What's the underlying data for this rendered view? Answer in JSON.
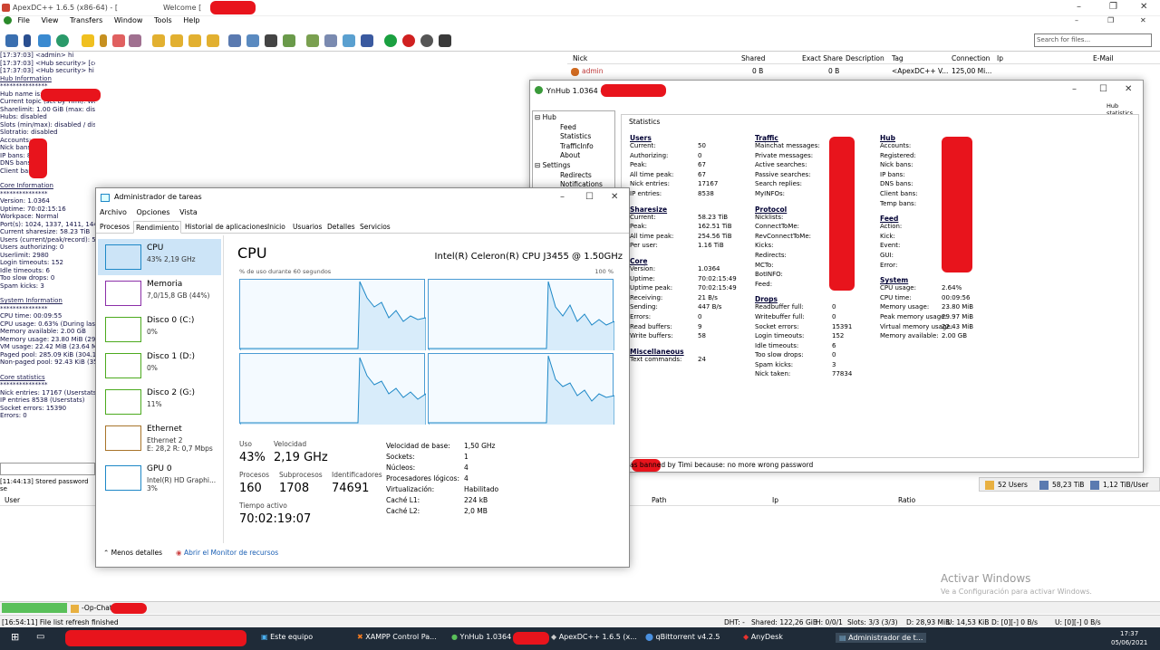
{
  "apex": {
    "title": "ApexDC++ 1.6.5 (x86-64) - [",
    "title_welcome": "Welcome [",
    "menu": [
      "File",
      "View",
      "Transfers",
      "Window",
      "Tools",
      "Help"
    ],
    "search_placeholder": "Search for files...",
    "chat": [
      {
        "ts": "[17:37:03]",
        "text": " <admin> hi"
      },
      {
        "ts": "[17:37:03]",
        "text": " <Hub security> [command] hi"
      },
      {
        "ts": "[17:37:03]",
        "text": " <Hub security> hi"
      }
    ],
    "hub_info_title": "Hub Information",
    "stars": "***************",
    "hub_info": [
      "Hub name is:",
      "Current topic (set by Timi): Welcome",
      "Sharelimit: 1.00 GiB (max: disabled)",
      "Hubs: disabled",
      "Slots (min/max): disabled / disabled",
      "Slotratio: disabled",
      "Accounts:",
      "Nick bans:",
      "IP bans: 8",
      "DNS bans:",
      "Client bans:"
    ],
    "core_info_title": "Core Information",
    "core_info": [
      "Version: 1.0364",
      "Uptime: 70:02:15:16",
      "Workpace: Normal",
      "Port(s): 1024, 1337, 1411, 1441,",
      "Current sharesize: 58.23 TiB",
      "Users (current/peak/record): 50",
      "Users authorizing: 0",
      "Userlimit: 2980",
      "Login timeouts: 152",
      "Idle timeouts: 6",
      "Too slow drops: 0",
      "Spam kicks: 3"
    ],
    "sys_info_title": "System Information",
    "sys_info": [
      "CPU time: 00:09:55",
      "CPU usage: 0.63% (During last 3",
      "Memory available: 2.00 GB",
      "Memory usage: 23.80 MiB (29.97",
      "VM usage: 22.42 MiB (23.64 Mi",
      "Paged pool: 285.09 KiB (304.10",
      "Non-paged pool: 92.43 KiB (359"
    ],
    "core_stats_title": "Core statistics",
    "core_stats": [
      "Nick entries: 17167 (Userstats)",
      "IP entries 8538 (Userstats)",
      "Socket errors: 15390",
      "Errors: 0"
    ],
    "userlist_cols": [
      "Nick",
      "Shared",
      "Exact Share",
      "Description",
      "Tag",
      "Connection",
      "Ip",
      "E-Mail"
    ],
    "user_row": {
      "nick": "admin",
      "shared": "0 B",
      "exact": "0 B",
      "tag": "<ApexDC++ V...",
      "conn": "125,00 Mi..."
    },
    "pwd_line": "[11:44:13] Stored password se",
    "right_status": {
      "users": "52 Users",
      "share": "58,23 TiB",
      "rate": "1,12 TiB/User"
    },
    "queue_cols": [
      "User",
      "Path",
      "Ip",
      "Ratio"
    ],
    "activate": "Activar Windows",
    "activate_sub": "Ve a Configuración para activar Windows.",
    "op_chat": "-Op-Chat-",
    "bottom_msg": "[16:54:11] File list refresh finished",
    "bottom_status": [
      "DHT: -",
      "Shared: 122,26 GiB",
      "H: 0/0/1",
      "Slots: 3/3 (3/3)",
      "D: 28,93 MiB",
      "U: 14,53 KiB",
      "D: [0][-] 0 B/s",
      "U: [0][-] 0 B/s"
    ]
  },
  "ynhub": {
    "title": "YnHub 1.0364 -",
    "subtitle": "Hub statistics",
    "tree": [
      "Hub",
      "Feed",
      "Statistics",
      "TrafficInfo",
      "About",
      "Settings",
      "Redirects",
      "Notifications"
    ],
    "panel_head": "Statistics",
    "banned": "as banned by Timi because: no more wrong password",
    "cols": [
      {
        "sections": [
          {
            "h": "Users",
            "rows": [
              [
                "Current:",
                "50"
              ],
              [
                "Authorizing:",
                "0"
              ],
              [
                "Peak:",
                "67"
              ],
              [
                "All time peak:",
                "67"
              ],
              [
                "Nick entries:",
                "17167"
              ],
              [
                "IP entries:",
                "8538"
              ]
            ]
          },
          {
            "h": "Sharesize",
            "rows": [
              [
                "Current:",
                "58.23 TiB"
              ],
              [
                "Peak:",
                "162.51 TiB"
              ],
              [
                "All time peak:",
                "254.56 TiB"
              ],
              [
                "Per user:",
                "1.16 TiB"
              ]
            ]
          },
          {
            "h": "Core",
            "rows": [
              [
                "Version:",
                "1.0364"
              ],
              [
                "Uptime:",
                "70:02:15:49"
              ],
              [
                "Uptime peak:",
                "70:02:15:49"
              ],
              [
                "Receiving:",
                "21 B/s"
              ],
              [
                "Sending:",
                "447 B/s"
              ],
              [
                "Errors:",
                "0"
              ],
              [
                "Read buffers:",
                "9"
              ],
              [
                "Write buffers:",
                "58"
              ]
            ]
          },
          {
            "h": "Miscellaneous",
            "rows": [
              [
                "Text commands:",
                "24"
              ]
            ]
          }
        ]
      },
      {
        "sections": [
          {
            "h": "Traffic",
            "rows": [
              [
                "Mainchat messages:",
                ""
              ],
              [
                "Private messages:",
                ""
              ],
              [
                "Active searches:",
                "77"
              ],
              [
                "Passive searches:",
                "67"
              ],
              [
                "Search replies:",
                "9"
              ],
              [
                "MyINFOs:",
                "55"
              ]
            ]
          },
          {
            "h": "Protocol",
            "rows": [
              [
                "Nicklists:",
                ""
              ],
              [
                "ConnectToMe:",
                "30"
              ],
              [
                "RevConnectToMe:",
                "36"
              ],
              [
                "Kicks:",
                ""
              ],
              [
                "Redirects:",
                ""
              ],
              [
                "MCTo:",
                ""
              ],
              [
                "BotINFO:",
                ""
              ],
              [
                "Feed:",
                ""
              ]
            ]
          },
          {
            "h": "Drops",
            "rows": [
              [
                "Readbuffer full:",
                "0"
              ],
              [
                "Writebuffer full:",
                "0"
              ],
              [
                "Socket errors:",
                "15391"
              ],
              [
                "Login timeouts:",
                "152"
              ],
              [
                "Idle timeouts:",
                "6"
              ],
              [
                "Too slow drops:",
                "0"
              ],
              [
                "Spam kicks:",
                "3"
              ],
              [
                "Nick taken:",
                "77834"
              ]
            ]
          }
        ]
      },
      {
        "sections": [
          {
            "h": "Hub",
            "rows": [
              [
                "Accounts:",
                ""
              ],
              [
                "Registered:",
                ""
              ],
              [
                "Nick bans:",
                ""
              ],
              [
                "IP bans:",
                ""
              ],
              [
                "DNS bans:",
                ""
              ],
              [
                "Client bans:",
                ""
              ],
              [
                "Temp bans:",
                ""
              ]
            ]
          },
          {
            "h": "Feed",
            "rows": [
              [
                "Action:",
                ""
              ],
              [
                "Kick:",
                ""
              ],
              [
                "Event:",
                ""
              ],
              [
                "GUI:",
                ""
              ],
              [
                "Error:",
                ""
              ]
            ]
          },
          {
            "h": "System",
            "rows": [
              [
                "CPU usage:",
                "2.64%"
              ],
              [
                "CPU time:",
                "00:09:56"
              ],
              [
                "Memory usage:",
                "23.80 MiB"
              ],
              [
                "Peak memory usage:",
                "29.97 MiB"
              ],
              [
                "Virtual memory usage:",
                "22.43 MiB"
              ],
              [
                "Memory available:",
                "2.00 GB"
              ]
            ]
          }
        ]
      }
    ]
  },
  "taskmgr": {
    "title": "Administrador de tareas",
    "menu": [
      "Archivo",
      "Opciones",
      "Vista"
    ],
    "tabs": [
      "Procesos",
      "Rendimiento",
      "Historial de aplicaciones",
      "Inicio",
      "Usuarios",
      "Detalles",
      "Servicios"
    ],
    "resources": [
      {
        "name": "CPU",
        "sub": "43% 2,19 GHz",
        "color": "#1e88c7"
      },
      {
        "name": "Memoria",
        "sub": "7,0/15,8 GB (44%)",
        "color": "#8b2fa8"
      },
      {
        "name": "Disco 0 (C:)",
        "sub": "0%",
        "color": "#4caa1e"
      },
      {
        "name": "Disco 1 (D:)",
        "sub": "0%",
        "color": "#4caa1e"
      },
      {
        "name": "Disco 2 (G:)",
        "sub": "11%",
        "color": "#4caa1e"
      },
      {
        "name": "Ethernet",
        "sub": "Ethernet 2",
        "sub2": "E: 28,2 R: 0,7 Mbps",
        "color": "#a8742a"
      },
      {
        "name": "GPU 0",
        "sub": "Intel(R) HD Graphi...",
        "sub2": "3%",
        "color": "#1e88c7"
      }
    ],
    "main_title": "CPU",
    "model": "Intel(R) Celeron(R) CPU J3455 @ 1.50GHz",
    "axis_label": "% de uso durante 60 segundos",
    "axis_max": "100 %",
    "metrics": {
      "uso_l": "Uso",
      "uso": "43%",
      "vel_l": "Velocidad",
      "vel": "2,19 GHz",
      "proc_l": "Procesos",
      "proc": "160",
      "sub_l": "Subprocesos",
      "sub": "1708",
      "id_l": "Identificadores",
      "id": "74691",
      "time_l": "Tiempo activo",
      "time": "70:02:19:07"
    },
    "details": [
      [
        "Velocidad de base:",
        "1,50 GHz"
      ],
      [
        "Sockets:",
        "1"
      ],
      [
        "Núcleos:",
        "4"
      ],
      [
        "Procesadores lógicos:",
        "4"
      ],
      [
        "Virtualización:",
        "Habilitado"
      ],
      [
        "Caché L1:",
        "224 kB"
      ],
      [
        "Caché L2:",
        "2,0 MB"
      ]
    ],
    "footer_less": "Menos detalles",
    "footer_link": "Abrir el Monitor de recursos"
  },
  "taskbar": {
    "items": [
      "Este equipo",
      "XAMPP Control Pa...",
      "YnHub 1.0364 -",
      "ApexDC++ 1.6.5 (x...",
      "qBittorrent v4.2.5",
      "AnyDesk",
      "Administrador de t..."
    ],
    "time": "17:37",
    "date": "05/06/2021"
  }
}
